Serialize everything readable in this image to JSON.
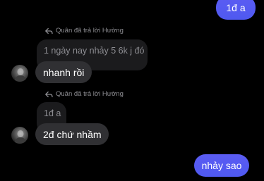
{
  "messages": {
    "out_top": {
      "text": "1đ a"
    },
    "reply_one": {
      "header": "Quân đã trả lời Hường",
      "quote": "1 ngày nay nhảy 5 6k j đó",
      "text": "nhanh rồi"
    },
    "reply_two": {
      "header": "Quân đã trả lời Hường",
      "quote": "1đ a",
      "text": "2đ chứ nhầm"
    },
    "out_bottom": {
      "text": "nhảy sao"
    }
  },
  "icons": {
    "reply": "reply-arrow-icon",
    "avatar": "avatar"
  },
  "colors": {
    "background": "#000000",
    "outgoing_bubble": "#5359f1",
    "incoming_bubble": "#303033",
    "quoted_bubble": "#1b1b1d",
    "meta_text": "#8e8e93"
  }
}
